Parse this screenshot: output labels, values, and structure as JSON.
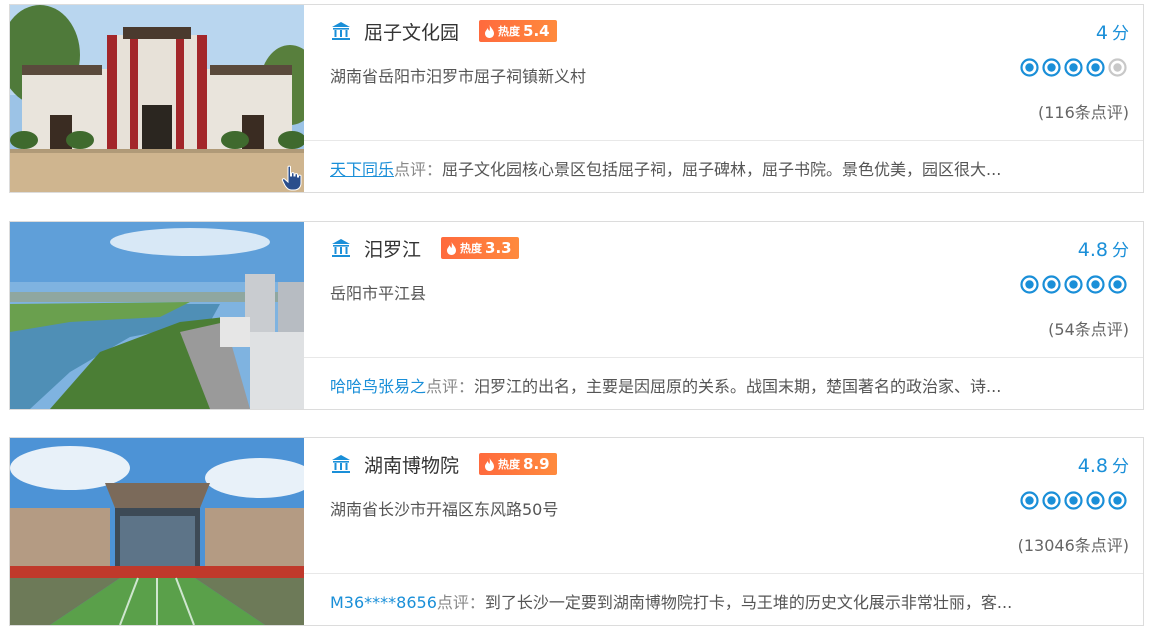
{
  "colors": {
    "accent_blue": "#1a8fd8",
    "heat_badge": "#ff6a3d",
    "rating_off": "#c8c8c8"
  },
  "icons": {
    "poi": "landmark-icon",
    "heat": "flame-icon",
    "rating": "rating-dot-icon",
    "cursor": "hand-cursor-icon"
  },
  "cards": [
    {
      "title": "屈子文化园",
      "heat_label": "热度",
      "heat_value": "5.4",
      "address": "湖南省岳阳市汨罗市屈子祠镇新义村",
      "score": "4",
      "score_unit": "分",
      "rating_filled": 4,
      "rating_total": 5,
      "review_count": "(116条点评)",
      "reviewer": "天下同乐",
      "review_label": "点评：",
      "review_text": "屈子文化园核心景区包括屈子祠，屈子碑林，屈子书院。景色优美，园区很大..."
    },
    {
      "title": "汨罗江",
      "heat_label": "热度",
      "heat_value": "3.3",
      "address": "岳阳市平江县",
      "score": "4.8",
      "score_unit": "分",
      "rating_filled": 5,
      "rating_total": 5,
      "review_count": "(54条点评)",
      "reviewer": "哈哈鸟张易之",
      "review_label": "点评：",
      "review_text": "汨罗江的出名，主要是因屈原的关系。战国末期，楚国著名的政治家、诗..."
    },
    {
      "title": "湖南博物院",
      "heat_label": "热度",
      "heat_value": "8.9",
      "address": "湖南省长沙市开福区东风路50号",
      "score": "4.8",
      "score_unit": "分",
      "rating_filled": 5,
      "rating_total": 5,
      "review_count": "(13046条点评)",
      "reviewer": "M36****8656",
      "review_label": "点评：",
      "review_text": "到了长沙一定要到湖南博物院打卡，马王堆的历史文化展示非常壮丽，客..."
    }
  ]
}
